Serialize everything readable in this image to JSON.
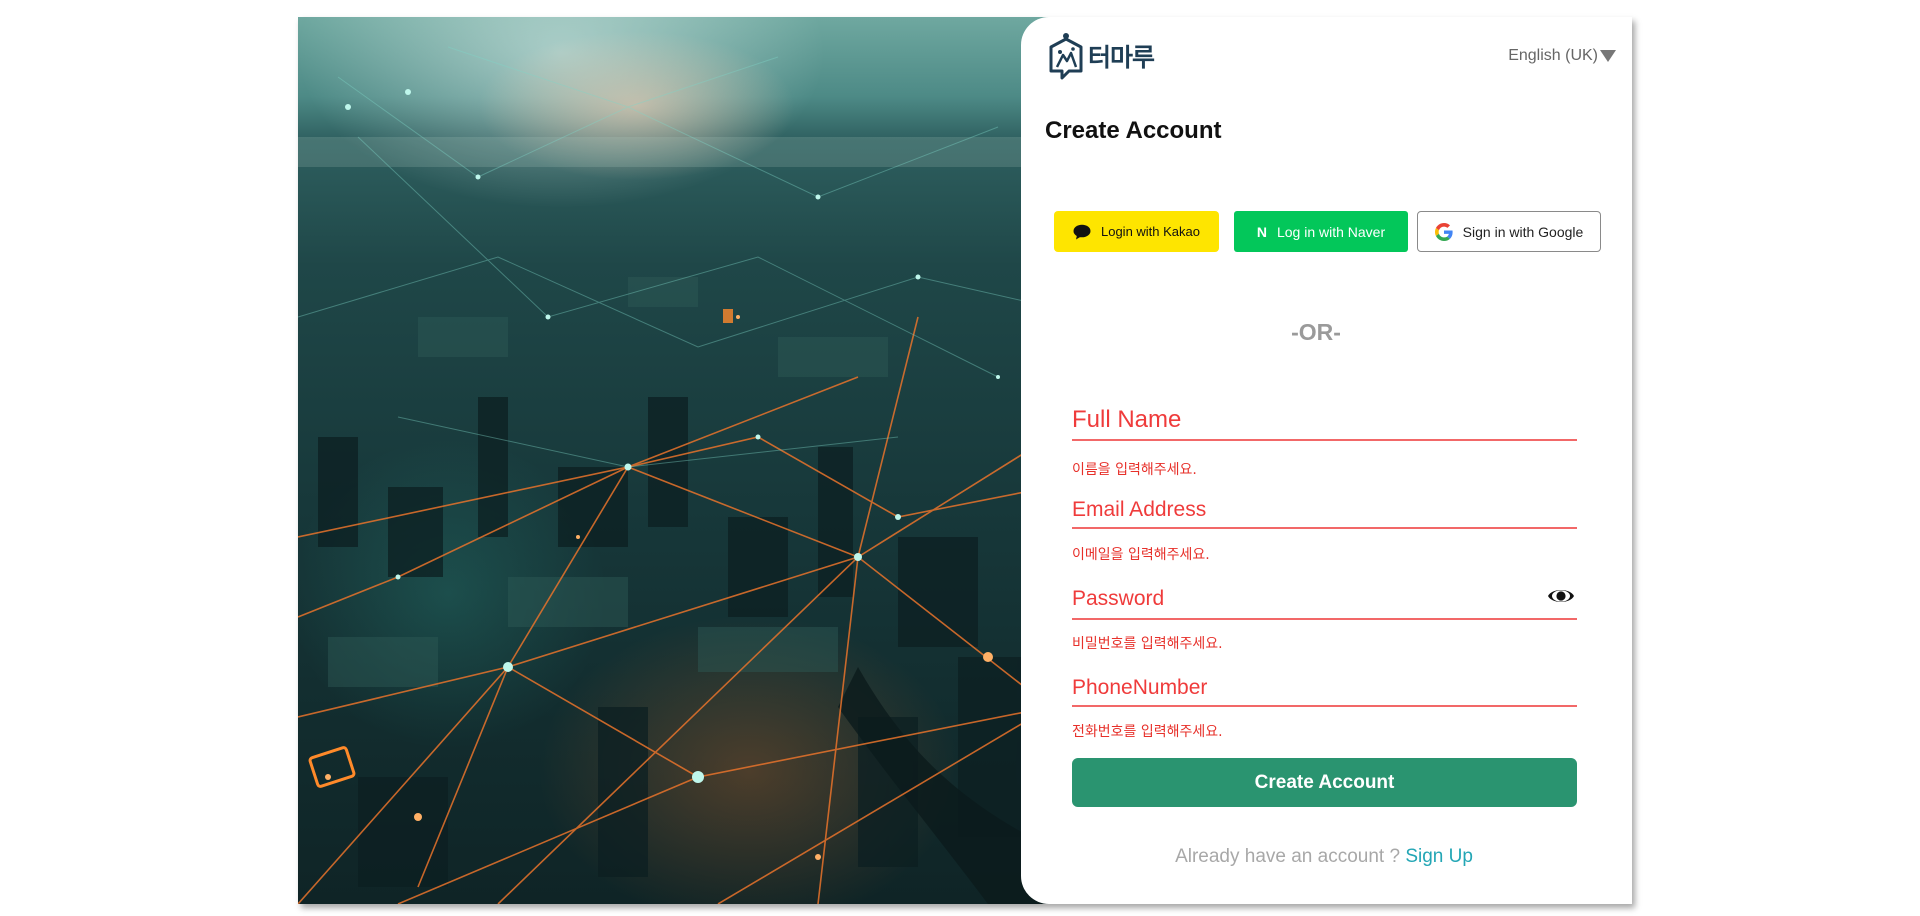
{
  "brand": {
    "name": "터마루"
  },
  "language": {
    "selected": "English (UK)"
  },
  "page": {
    "title": "Create Account"
  },
  "social": {
    "kakao_label": "Login with Kakao",
    "naver_label": "Log in with Naver",
    "naver_letter": "N",
    "google_label": "Sign in with Google"
  },
  "divider": "-OR-",
  "form": {
    "full_name": {
      "placeholder": "Full Name",
      "value": "",
      "error": "이름을 입력해주세요."
    },
    "email": {
      "placeholder": "Email Address",
      "value": "",
      "error": "이메일을 입력해주세요."
    },
    "password": {
      "placeholder": "Password",
      "value": "",
      "error": "비밀번호를 입력해주세요."
    },
    "phone": {
      "placeholder": "PhoneNumber",
      "value": "",
      "error": "전화번호를 입력해주세요."
    },
    "submit_label": "Create Account"
  },
  "footer": {
    "prompt": "Already have an account ? ",
    "link": "Sign Up"
  },
  "colors": {
    "primary": "#2a9470",
    "error": "#ef3b3b",
    "kakao": "#fee500",
    "naver": "#03c75a",
    "link": "#23a6b5",
    "brand_text": "#1f3e55"
  },
  "icons": {
    "logo": "house-map-pin-icon",
    "language_caret": "caret-down-icon",
    "kakao": "speech-bubble-icon",
    "naver": "naver-n-icon",
    "google": "google-g-icon",
    "password_toggle": "eye-icon"
  }
}
